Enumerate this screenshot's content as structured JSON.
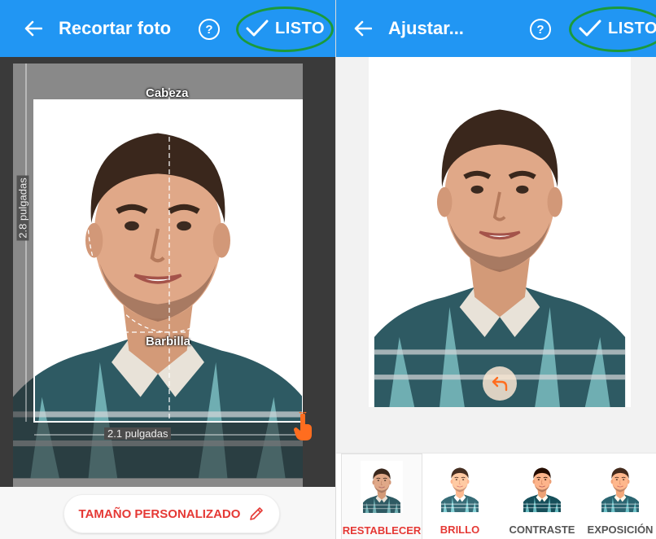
{
  "left_screen": {
    "title": "Recortar foto",
    "done_label": "LISTO",
    "guides": {
      "head_label": "Cabeza",
      "chin_label": "Barbilla",
      "height_label": "2.8 pulgadas",
      "width_label": "2.1 pulgadas"
    },
    "custom_size_label": "TAMAÑO PERSONALIZADO"
  },
  "right_screen": {
    "title": "Ajustar...",
    "done_label": "LISTO",
    "filters": [
      {
        "label": "RESTABLECER",
        "selected": true,
        "color": "#e53935"
      },
      {
        "label": "BRILLO",
        "selected": false,
        "color": "#e53935"
      },
      {
        "label": "CONTRASTE",
        "selected": false,
        "color": "#555555"
      },
      {
        "label": "EXPOSICIÓN",
        "selected": false,
        "color": "#555555"
      }
    ]
  },
  "colors": {
    "app_bar": "#2196f3",
    "accent_red": "#e53935",
    "highlight_green": "#1b9a3b",
    "handle_orange": "#ff6d1f"
  },
  "icons": [
    "back-arrow-icon",
    "help-icon",
    "check-icon",
    "resize-handle-icon",
    "pencil-icon",
    "undo-icon"
  ]
}
